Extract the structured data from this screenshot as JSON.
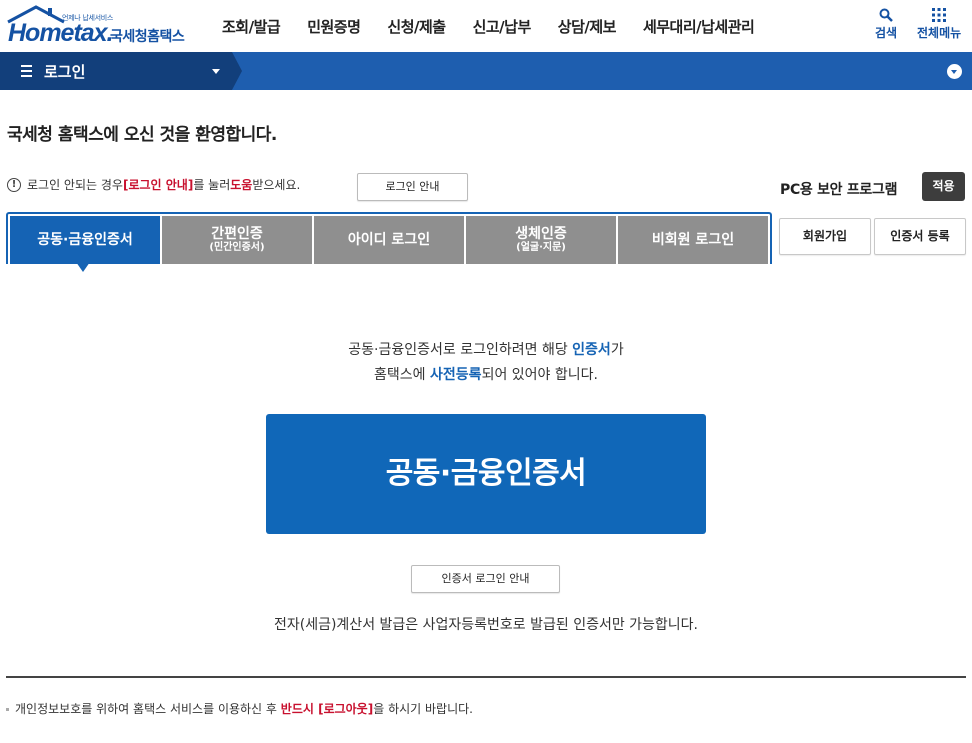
{
  "header": {
    "logo_tagline": "언제나 납세서비스",
    "logo_text": "Hometax.",
    "logo_org": "국세청홈택스",
    "nav": [
      "조회/발급",
      "민원증명",
      "신청/제출",
      "신고/납부",
      "상담/제보",
      "세무대리/납세관리"
    ],
    "search_label": "검색",
    "allmenu_label": "전체메뉴"
  },
  "titlebar": {
    "title": "로그인"
  },
  "welcome": "국세청 홈택스에 오신 것을 환영합니다.",
  "notice": {
    "prefix": "로그인 안되는 경우 ",
    "link": "[로그인 안내]",
    "middle": "를 눌러 ",
    "help": "도움",
    "suffix": "받으세요.",
    "guide_button": "로그인 안내"
  },
  "security": {
    "label": "PC용 보안 프로그램",
    "apply": "적용"
  },
  "tabs": [
    {
      "label": "공동·금융인증서",
      "sub": "",
      "active": true
    },
    {
      "label": "간편인증",
      "sub": "(민간인증서)",
      "active": false
    },
    {
      "label": "아이디 로그인",
      "sub": "",
      "active": false
    },
    {
      "label": "생체인증",
      "sub": "(얼굴·지문)",
      "active": false
    },
    {
      "label": "비회원 로그인",
      "sub": "",
      "active": false
    }
  ],
  "side_buttons": {
    "join": "회원가입",
    "cert_register": "인증서 등록"
  },
  "main": {
    "desc1_a": "공동·금융인증서로 로그인하려면 해당 ",
    "desc1_b": "인증서",
    "desc1_c": "가",
    "desc2_a": "홈택스에 ",
    "desc2_b": "사전등록",
    "desc2_c": "되어 있어야 합니다.",
    "big_button": "공동·금융인증서",
    "cert_guide_button": "인증서 로그인 안내",
    "note": "전자(세금)계산서 발급은 사업자등록번호로 발급된 인증서만 가능합니다."
  },
  "footer": {
    "prefix": "개인정보보호를 위하여 홈택스 서비스를 이용하신 후 ",
    "emph": "반드시 [로그아웃]",
    "suffix": "을 하시기 바랍니다."
  }
}
